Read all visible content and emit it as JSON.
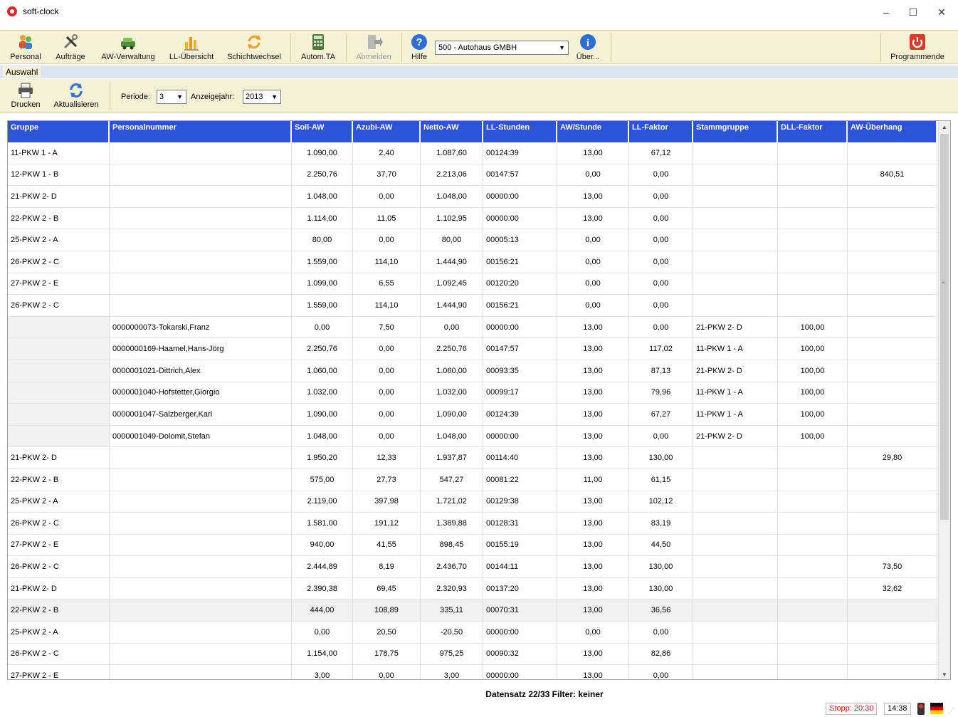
{
  "window": {
    "title": "soft-clock",
    "minimize_symbol": "–",
    "maximize_symbol": "☐",
    "close_symbol": "✕"
  },
  "toolbar": {
    "personal": "Personal",
    "auftraege": "Aufträge",
    "aw_verwaltung": "AW-Verwaltung",
    "ll_uebersicht": "LL-Übersicht",
    "schichtwechsel": "Schichtwechsel",
    "autom_ta": "Autom.TA",
    "abmelden": "Abmelden",
    "hilfe": "Hilfe",
    "company": "500 - Autohaus GMBH",
    "ueber": "Über...",
    "programmende": "Programmende"
  },
  "tabs": {
    "auswahl": "Auswahl"
  },
  "subtoolbar": {
    "drucken": "Drucken",
    "aktualisieren": "Aktualisieren",
    "periode_label": "Periode:",
    "periode_value": "3",
    "anzeigejahr_label": "Anzeigejahr:",
    "anzeigejahr_value": "2013"
  },
  "table": {
    "columns": [
      "Gruppe",
      "Personalnummer",
      "Soll-AW",
      "Azubi-AW",
      "Netto-AW",
      "LL-Stunden",
      "AW/Stunde",
      "LL-Faktor",
      "Stammgruppe",
      "DLL-Faktor",
      "AW-Überhang"
    ],
    "rows": [
      [
        "11-PKW 1 - A",
        "",
        "1.090,00",
        "2,40",
        "1.087,60",
        "00124:39",
        "13,00",
        "67,12",
        "",
        "",
        ""
      ],
      [
        "12-PKW 1 - B",
        "",
        "2.250,76",
        "37,70",
        "2.213,06",
        "00147:57",
        "0,00",
        "0,00",
        "",
        "",
        "840,51"
      ],
      [
        "21-PKW 2- D",
        "",
        "1.048,00",
        "0,00",
        "1.048,00",
        "00000:00",
        "13,00",
        "0,00",
        "",
        "",
        ""
      ],
      [
        "22-PKW 2 - B",
        "",
        "1.114,00",
        "11,05",
        "1.102,95",
        "00000:00",
        "13,00",
        "0,00",
        "",
        "",
        ""
      ],
      [
        "25-PKW 2 - A",
        "",
        "80,00",
        "0,00",
        "80,00",
        "00005:13",
        "0,00",
        "0,00",
        "",
        "",
        ""
      ],
      [
        "26-PKW 2 - C",
        "",
        "1.559,00",
        "114,10",
        "1.444,90",
        "00156:21",
        "0,00",
        "0,00",
        "",
        "",
        ""
      ],
      [
        "27-PKW 2 - E",
        "",
        "1.099,00",
        "6,55",
        "1.092,45",
        "00120:20",
        "0,00",
        "0,00",
        "",
        "",
        ""
      ],
      [
        "26-PKW 2 - C",
        "",
        "1.559,00",
        "114,10",
        "1.444,90",
        "00156:21",
        "0,00",
        "0,00",
        "",
        "",
        ""
      ],
      [
        "",
        "0000000073-Tokarski,Franz",
        "0,00",
        "7,50",
        "0,00",
        "00000:00",
        "13,00",
        "0,00",
        "21-PKW 2- D",
        "100,00",
        ""
      ],
      [
        "",
        "0000000169-Haamel,Hans-Jörg",
        "2.250,76",
        "0,00",
        "2.250,76",
        "00147:57",
        "13,00",
        "117,02",
        "11-PKW 1 - A",
        "100,00",
        ""
      ],
      [
        "",
        "0000001021-Dittrich,Alex",
        "1.060,00",
        "0,00",
        "1.060,00",
        "00093:35",
        "13,00",
        "87,13",
        "21-PKW 2- D",
        "100,00",
        ""
      ],
      [
        "",
        "0000001040-Hofstetter,Giorgio",
        "1.032,00",
        "0,00",
        "1.032,00",
        "00099:17",
        "13,00",
        "79,96",
        "11-PKW 1 - A",
        "100,00",
        ""
      ],
      [
        "",
        "0000001047-Salzberger,Karl",
        "1.090,00",
        "0,00",
        "1.090,00",
        "00124:39",
        "13,00",
        "67,27",
        "11-PKW 1 - A",
        "100,00",
        ""
      ],
      [
        "",
        "0000001049-Dolomit,Stefan",
        "1.048,00",
        "0,00",
        "1.048,00",
        "00000:00",
        "13,00",
        "0,00",
        "21-PKW 2- D",
        "100,00",
        ""
      ],
      [
        "21-PKW 2- D",
        "",
        "1.950,20",
        "12,33",
        "1.937,87",
        "00114:40",
        "13,00",
        "130,00",
        "",
        "",
        "29,80"
      ],
      [
        "22-PKW 2 - B",
        "",
        "575,00",
        "27,73",
        "547,27",
        "00081:22",
        "11,00",
        "61,15",
        "",
        "",
        ""
      ],
      [
        "25-PKW 2 - A",
        "",
        "2.119,00",
        "397,98",
        "1.721,02",
        "00129:38",
        "13,00",
        "102,12",
        "",
        "",
        ""
      ],
      [
        "26-PKW 2 - C",
        "",
        "1.581,00",
        "191,12",
        "1.389,88",
        "00128:31",
        "13,00",
        "83,19",
        "",
        "",
        ""
      ],
      [
        "27-PKW 2 - E",
        "",
        "940,00",
        "41,55",
        "898,45",
        "00155:19",
        "13,00",
        "44,50",
        "",
        "",
        ""
      ],
      [
        "26-PKW 2 - C",
        "",
        "2.444,89",
        "8,19",
        "2.436,70",
        "00144:11",
        "13,00",
        "130,00",
        "",
        "",
        "73,50"
      ],
      [
        "21-PKW 2- D",
        "",
        "2.390,38",
        "69,45",
        "2.320,93",
        "00137:20",
        "13,00",
        "130,00",
        "",
        "",
        "32,62"
      ],
      [
        "22-PKW 2 - B",
        "",
        "444,00",
        "108,89",
        "335,11",
        "00070:31",
        "13,00",
        "36,56",
        "",
        "",
        ""
      ],
      [
        "25-PKW 2 - A",
        "",
        "0,00",
        "20,50",
        "-20,50",
        "00000:00",
        "0,00",
        "0,00",
        "",
        "",
        ""
      ],
      [
        "26-PKW 2 - C",
        "",
        "1.154,00",
        "178,75",
        "975,25",
        "00090:32",
        "13,00",
        "82,86",
        "",
        "",
        ""
      ],
      [
        "27-PKW 2 - E",
        "",
        "3,00",
        "0,00",
        "3,00",
        "00000:00",
        "13,00",
        "0,00",
        "",
        "",
        ""
      ]
    ]
  },
  "status": {
    "text": "Datensatz 22/33 Filter: keiner",
    "stop": "Stopp: 20:30",
    "time": "14:38"
  },
  "colors": {
    "header_blue": "#2b55d6",
    "toolbar_bg": "#f5f1d4",
    "stop_red": "#d02020"
  }
}
